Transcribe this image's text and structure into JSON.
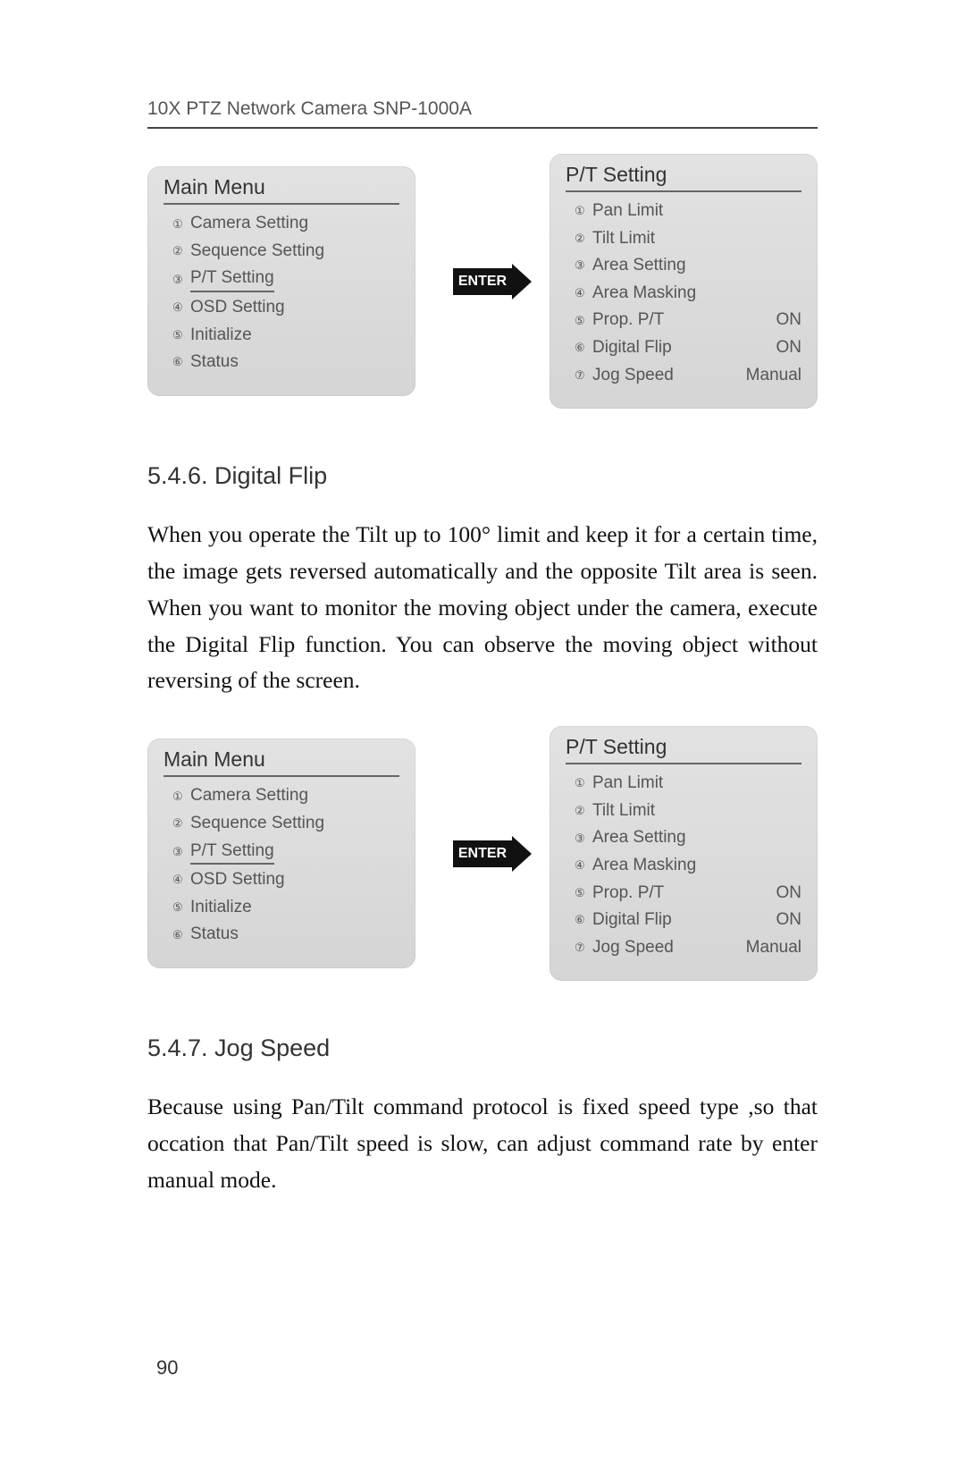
{
  "header": "10X PTZ Network Camera SNP-1000A",
  "diagram": {
    "enter_label": "ENTER",
    "main": {
      "title": "Main Menu",
      "highlight_index": 2,
      "items": [
        {
          "marker": "①",
          "label": "Camera Setting"
        },
        {
          "marker": "②",
          "label": "Sequence Setting"
        },
        {
          "marker": "③",
          "label": "P/T Setting"
        },
        {
          "marker": "④",
          "label": "OSD Setting"
        },
        {
          "marker": "⑤",
          "label": "Initialize"
        },
        {
          "marker": "⑥",
          "label": "Status"
        }
      ]
    },
    "pt": {
      "title": "P/T Setting",
      "items": [
        {
          "marker": "①",
          "label": "Pan Limit",
          "value": ""
        },
        {
          "marker": "②",
          "label": "Tilt Limit",
          "value": ""
        },
        {
          "marker": "③",
          "label": "Area Setting",
          "value": ""
        },
        {
          "marker": "④",
          "label": "Area Masking",
          "value": ""
        },
        {
          "marker": "⑤",
          "label": "Prop. P/T",
          "value": "ON"
        },
        {
          "marker": "⑥",
          "label": "Digital Flip",
          "value": "ON"
        },
        {
          "marker": "⑦",
          "label": "Jog Speed",
          "value": "Manual"
        }
      ]
    }
  },
  "section1": {
    "heading": "5.4.6. Digital Flip",
    "body": "When you operate the Tilt up to 100° limit and keep it for a certain time, the image gets reversed automatically and the opposite Tilt area is seen. When you want to monitor the moving object under the camera, execute the Digital Flip function. You can observe the moving object without reversing of the screen."
  },
  "section2": {
    "heading": "5.4.7. Jog Speed",
    "body": "Because using Pan/Tilt command protocol is fixed speed type ,so that occation that Pan/Tilt speed is slow, can adjust command rate by enter manual mode."
  },
  "page_num": "90"
}
